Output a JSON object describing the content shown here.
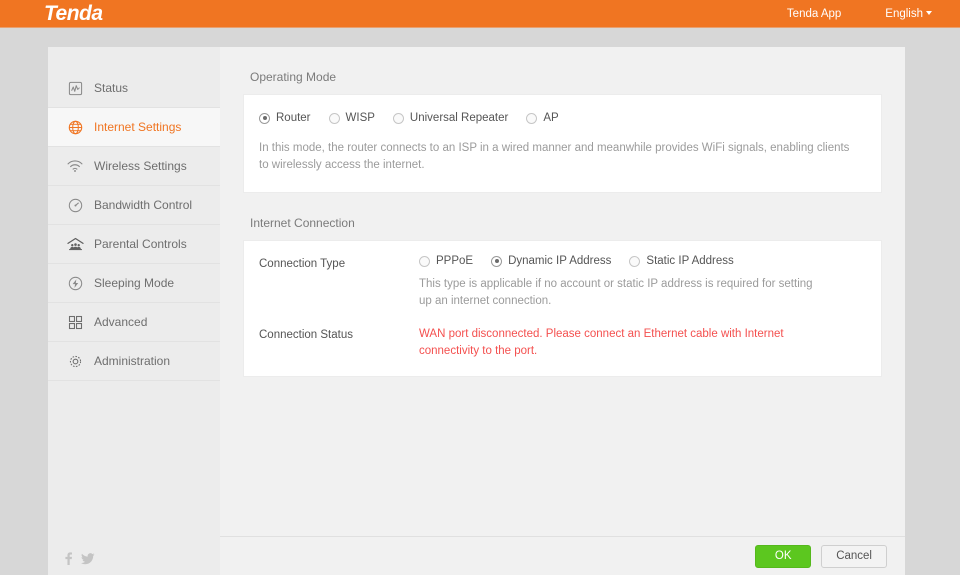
{
  "header": {
    "logo_text": "Tenda",
    "app_link": "Tenda App",
    "language": "English",
    "brand_color": "#f07522"
  },
  "sidebar": {
    "items": [
      {
        "label": "Status",
        "icon": "chart-square-icon",
        "active": false
      },
      {
        "label": "Internet Settings",
        "icon": "globe-icon",
        "active": true
      },
      {
        "label": "Wireless Settings",
        "icon": "wifi-icon",
        "active": false
      },
      {
        "label": "Bandwidth Control",
        "icon": "gauge-icon",
        "active": false
      },
      {
        "label": "Parental Controls",
        "icon": "family-home-icon",
        "active": false
      },
      {
        "label": "Sleeping Mode",
        "icon": "power-circle-icon",
        "active": false
      },
      {
        "label": "Advanced",
        "icon": "grid-squares-icon",
        "active": false
      },
      {
        "label": "Administration",
        "icon": "gear-icon",
        "active": false
      }
    ],
    "social": [
      {
        "name": "facebook-icon"
      },
      {
        "name": "twitter-icon"
      }
    ]
  },
  "main": {
    "operating_mode": {
      "section_title": "Operating Mode",
      "options": [
        {
          "label": "Router",
          "selected": true
        },
        {
          "label": "WISP",
          "selected": false
        },
        {
          "label": "Universal Repeater",
          "selected": false
        },
        {
          "label": "AP",
          "selected": false
        }
      ],
      "description": "In this mode, the router connects to an ISP in a wired manner and meanwhile provides WiFi signals, enabling clients to wirelessly access the internet."
    },
    "internet_connection": {
      "section_title": "Internet Connection",
      "connection_type_label": "Connection Type",
      "connection_type_options": [
        {
          "label": "PPPoE",
          "selected": false
        },
        {
          "label": "Dynamic IP Address",
          "selected": true
        },
        {
          "label": "Static IP Address",
          "selected": false
        }
      ],
      "connection_type_help": "This type is applicable if no account or static IP address is required for setting up an internet connection.",
      "connection_status_label": "Connection Status",
      "connection_status_value": "WAN port disconnected. Please connect an Ethernet cable with Internet connectivity to the port.",
      "status_color": "#f4504f"
    }
  },
  "footer": {
    "ok_label": "OK",
    "cancel_label": "Cancel",
    "ok_color": "#5cc71f"
  }
}
